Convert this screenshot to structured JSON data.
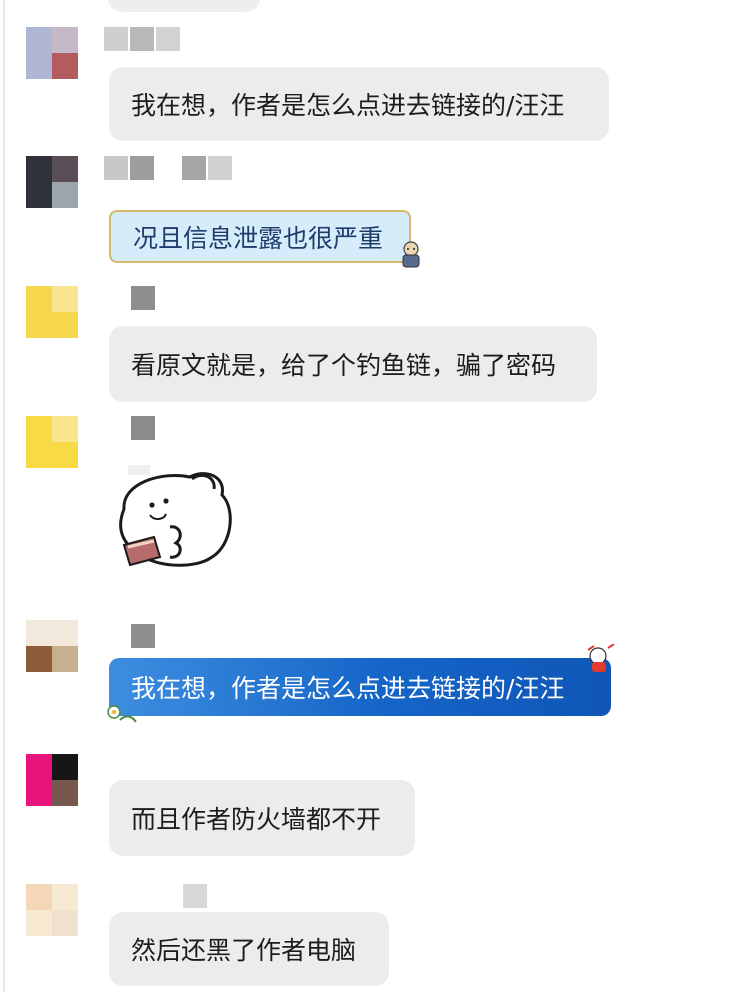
{
  "messages": [
    {
      "text": "我在想，作者是怎么点进去链接的/汪汪",
      "style": "gray"
    },
    {
      "text": "况且信息泄露也很严重",
      "style": "bubble-blue"
    },
    {
      "text": "看原文就是，给了个钓鱼链，骗了密码",
      "style": "gray"
    },
    {
      "sticker": "cartoon-character-eating-icon"
    },
    {
      "text": "我在想，作者是怎么点进去链接的/汪汪",
      "style": "dark-blue"
    },
    {
      "text": "而且作者防火墙都不开",
      "style": "gray"
    },
    {
      "text": "然后还黑了作者电脑",
      "style": "gray"
    }
  ],
  "colors": {
    "gray_bubble": "#ececec",
    "light_blue_bubble": "#d6ecfb",
    "gold_border": "#d3b76a",
    "dark_blue_bubble": "#1565c8"
  }
}
